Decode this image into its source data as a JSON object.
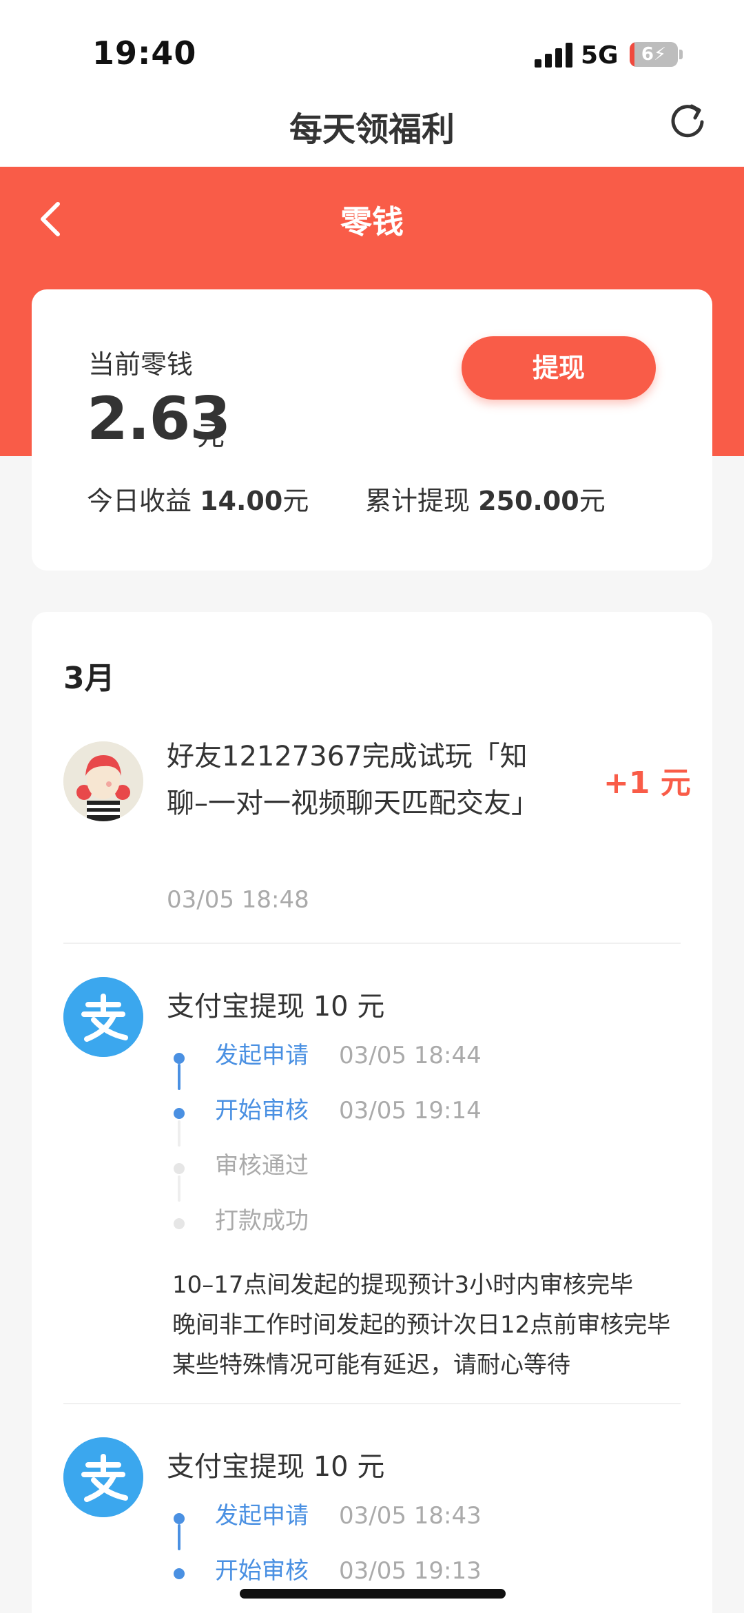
{
  "status_bar": {
    "time": "19:40",
    "network": "5G",
    "battery": "6"
  },
  "header": {
    "title": "每天领福利",
    "refresh_icon": "refresh-icon"
  },
  "page": {
    "title": "零钱",
    "back_icon": "chevron-left-icon"
  },
  "balance": {
    "label": "当前零钱",
    "amount": "2.63",
    "unit": "元",
    "withdraw_label": "提现",
    "today_label": "今日收益",
    "today_value": "14.00",
    "today_unit": "元",
    "total_label": "累计提现",
    "total_value": "250.00",
    "total_unit": "元"
  },
  "history": {
    "month": "3月",
    "entries": [
      {
        "text": "好友12127367完成试玩「知聊–一对一视频聊天匹配交友」",
        "amount": "+1 元",
        "time": "03/05 18:48"
      }
    ],
    "withdrawals": [
      {
        "title": "支付宝提现 10 元",
        "steps": [
          {
            "label": "发起申请",
            "time": "03/05 18:44",
            "state": "done"
          },
          {
            "label": "开始审核",
            "time": "03/05 19:14",
            "state": "done"
          },
          {
            "label": "审核通过",
            "time": "",
            "state": "pending"
          },
          {
            "label": "打款成功",
            "time": "",
            "state": "pending"
          }
        ],
        "note": [
          "10–17点间发起的提现预计3小时内审核完毕",
          "晚间非工作时间发起的预计次日12点前审核完毕",
          "某些特殊情况可能有延迟，请耐心等待"
        ]
      },
      {
        "title": "支付宝提现 10 元",
        "steps": [
          {
            "label": "发起申请",
            "time": "03/05 18:43",
            "state": "done"
          },
          {
            "label": "开始审核",
            "time": "03/05 19:13",
            "state": "done"
          }
        ]
      }
    ]
  },
  "colors": {
    "accent": "#f95c48",
    "alipay": "#3ba7ee",
    "step_done": "#4a90e2"
  }
}
